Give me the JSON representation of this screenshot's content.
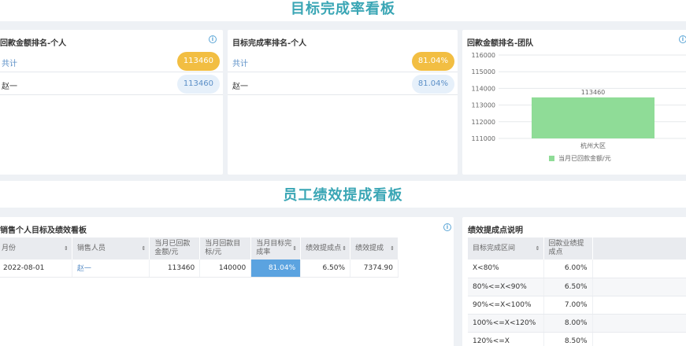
{
  "sections": {
    "top_title": "目标完成率看板",
    "bottom_title": "员工绩效提成看板"
  },
  "card1": {
    "title": "回款金额排名-个人",
    "rows": [
      {
        "label": "共计",
        "value": "113460"
      },
      {
        "label": "赵一",
        "value": "113460"
      }
    ]
  },
  "card2": {
    "title": "目标完成率排名-个人",
    "rows": [
      {
        "label": "共计",
        "value": "81.04%"
      },
      {
        "label": "赵一",
        "value": "81.04%"
      }
    ]
  },
  "card3": {
    "title": "回款金额排名-团队"
  },
  "chart_data": {
    "type": "bar",
    "categories": [
      "杭州大区"
    ],
    "series": [
      {
        "name": "当月已回款金额/元",
        "values": [
          113460
        ]
      }
    ],
    "data_labels": [
      "113460"
    ],
    "ylim": [
      111000,
      116000
    ],
    "yticks": [
      "116000",
      "115000",
      "114000",
      "113000",
      "112000",
      "111000"
    ],
    "grid": true,
    "legend_position": "bottom",
    "color": "#8fdc97"
  },
  "table1": {
    "title": "销售个人目标及绩效看板",
    "headers": [
      "月份",
      "销售人员",
      "当月已回款金额/元",
      "当月回款目标/元",
      "当月目标完成率",
      "绩效提成点",
      "绩效提成"
    ],
    "rows": [
      [
        "2022-08-01",
        "赵一",
        "113460",
        "140000",
        "81.04%",
        "6.50%",
        "7374.90"
      ]
    ]
  },
  "table2": {
    "title": "绩效提成点说明",
    "headers": [
      "目标完成区间",
      "回款业绩提成点"
    ],
    "rows": [
      [
        "X<80%",
        "6.00%"
      ],
      [
        "80%<=X<90%",
        "6.50%"
      ],
      [
        "90%<=X<100%",
        "7.00%"
      ],
      [
        "100%<=X<120%",
        "8.00%"
      ],
      [
        "120%<=X",
        "8.50%"
      ]
    ]
  },
  "colors": {
    "accent_title": "#3aa6b5",
    "gold_pill": "#f2be42",
    "highlight_cell": "#5ba3e0",
    "bar": "#8fdc97"
  },
  "icons": {
    "info": "i",
    "sort": "⇕"
  }
}
